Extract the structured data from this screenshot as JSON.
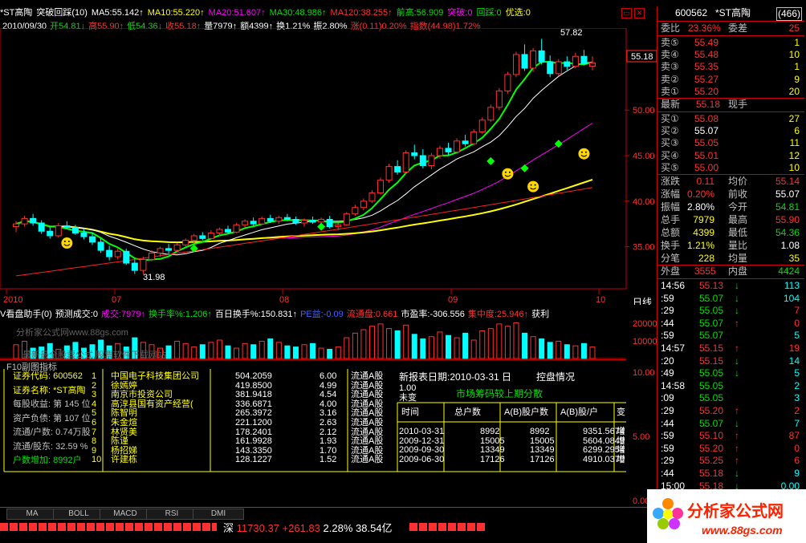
{
  "header": {
    "stock_title": "*ST高陶",
    "indicator": "突破回踩(10)",
    "ma5": "MA5:55.142↑",
    "ma10": "MA10:55.220↑",
    "ma20": "MA20:51.607↑",
    "ma30": "MA30:48.986↑",
    "ma120": "MA120:38.255↑",
    "prev_high": "前高:56.909",
    "breakout": "突破:0",
    "pullback": "回踩:0",
    "pick": "优选:0",
    "date": "2010/09/30",
    "open": "开54.81↓",
    "high": "高55.90↑",
    "low": "低54.36↓",
    "close": "收55.18↑",
    "volume": "量7979↑",
    "amount": "额4399↑",
    "turnover": "换1.21%",
    "amplitude": "振2.80%",
    "change": "涨(0.11)0.20%",
    "index": "指数(44.98)1.72%"
  },
  "chart_data": {
    "type": "candlestick",
    "x_labels": [
      "2010",
      "07",
      "08",
      "09",
      "10"
    ],
    "y_ticks": [
      35.0,
      40.0,
      45.0,
      50.0
    ],
    "price_tag": "55.18",
    "annotation_high": "57.82",
    "annotation_low": "31.98",
    "period_label": "日线",
    "ylim": [
      31,
      59
    ],
    "candles": [
      [
        37.2,
        37.8,
        36.6,
        37.5
      ],
      [
        37.5,
        38.4,
        37.2,
        38.1
      ],
      [
        38.1,
        38.6,
        37.3,
        37.6
      ],
      [
        37.6,
        37.9,
        36.4,
        36.7
      ],
      [
        36.7,
        37.2,
        35.9,
        36.2
      ],
      [
        36.2,
        37.6,
        36.0,
        37.3
      ],
      [
        37.3,
        37.8,
        36.9,
        37.1
      ],
      [
        37.1,
        37.4,
        36.3,
        36.5
      ],
      [
        36.5,
        36.9,
        35.8,
        36.1
      ],
      [
        36.1,
        36.6,
        35.2,
        35.5
      ],
      [
        35.5,
        35.9,
        34.3,
        34.6
      ],
      [
        34.6,
        35.1,
        33.5,
        33.9
      ],
      [
        33.9,
        34.8,
        33.6,
        34.5
      ],
      [
        34.5,
        34.8,
        33.0,
        33.2
      ],
      [
        33.2,
        33.6,
        32.0,
        32.4
      ],
      [
        32.4,
        33.9,
        31.98,
        33.6
      ],
      [
        33.6,
        34.6,
        33.4,
        34.3
      ],
      [
        34.3,
        35.0,
        33.9,
        34.8
      ],
      [
        34.8,
        35.3,
        34.2,
        34.6
      ],
      [
        34.6,
        35.4,
        34.4,
        35.2
      ],
      [
        35.2,
        35.9,
        35.0,
        35.7
      ],
      [
        35.7,
        36.4,
        35.4,
        36.2
      ],
      [
        36.2,
        36.6,
        35.7,
        35.9
      ],
      [
        35.9,
        36.8,
        35.8,
        36.5
      ],
      [
        36.5,
        37.1,
        36.2,
        36.9
      ],
      [
        36.9,
        37.3,
        36.4,
        36.6
      ],
      [
        36.6,
        37.6,
        36.5,
        37.4
      ],
      [
        37.4,
        38.0,
        37.1,
        37.8
      ],
      [
        37.8,
        38.2,
        37.3,
        37.5
      ],
      [
        37.5,
        38.3,
        37.4,
        38.1
      ],
      [
        38.1,
        38.5,
        37.6,
        37.8
      ],
      [
        37.8,
        38.4,
        37.5,
        38.2
      ],
      [
        38.2,
        38.6,
        37.8,
        38.0
      ],
      [
        38.0,
        38.3,
        37.4,
        37.6
      ],
      [
        37.6,
        38.1,
        37.2,
        37.9
      ],
      [
        37.9,
        38.3,
        37.5,
        37.7
      ],
      [
        37.7,
        38.2,
        37.3,
        38.0
      ],
      [
        38.0,
        38.4,
        37.0,
        37.2
      ],
      [
        37.2,
        37.6,
        36.8,
        37.4
      ],
      [
        37.4,
        38.8,
        37.3,
        38.6
      ],
      [
        38.6,
        39.6,
        38.4,
        39.3
      ],
      [
        39.3,
        40.3,
        39.0,
        40.0
      ],
      [
        40.0,
        41.2,
        39.8,
        40.9
      ],
      [
        40.9,
        42.6,
        40.7,
        42.3
      ],
      [
        42.3,
        44.1,
        42.0,
        43.8
      ],
      [
        43.8,
        44.5,
        42.9,
        43.2
      ],
      [
        43.2,
        45.6,
        43.0,
        45.3
      ],
      [
        45.3,
        46.2,
        44.6,
        45.0
      ],
      [
        45.0,
        45.7,
        43.6,
        43.9
      ],
      [
        43.9,
        45.3,
        43.5,
        45.0
      ],
      [
        45.0,
        46.1,
        44.7,
        45.8
      ],
      [
        45.8,
        46.4,
        45.1,
        45.4
      ],
      [
        45.4,
        46.9,
        45.2,
        46.6
      ],
      [
        46.6,
        47.3,
        46.0,
        46.3
      ],
      [
        46.3,
        47.9,
        46.1,
        47.6
      ],
      [
        47.6,
        49.2,
        47.4,
        48.9
      ],
      [
        48.9,
        50.6,
        48.7,
        50.3
      ],
      [
        50.3,
        52.4,
        50.0,
        52.1
      ],
      [
        52.1,
        54.2,
        51.8,
        53.9
      ],
      [
        53.9,
        56.4,
        53.6,
        56.1
      ],
      [
        56.1,
        57.2,
        54.3,
        54.6
      ],
      [
        54.6,
        56.8,
        54.2,
        56.5
      ],
      [
        56.5,
        57.82,
        55.0,
        55.3
      ],
      [
        55.3,
        56.0,
        53.6,
        54.0
      ],
      [
        54.0,
        55.6,
        53.7,
        55.3
      ],
      [
        55.3,
        55.9,
        54.4,
        54.8
      ],
      [
        54.8,
        56.3,
        54.6,
        55.9
      ],
      [
        55.9,
        56.6,
        54.9,
        55.07
      ],
      [
        54.81,
        55.9,
        54.36,
        55.18
      ]
    ],
    "vol_ticks": [
      "20000",
      "10000"
    ],
    "vol_values": [
      12,
      15,
      9,
      10,
      13,
      8,
      11,
      14,
      9,
      12,
      16,
      11,
      13,
      10,
      18,
      14,
      12,
      9,
      11,
      15,
      13,
      10,
      12,
      14,
      16,
      11,
      9,
      13,
      12,
      15,
      17,
      14,
      11,
      10,
      12,
      13,
      9,
      8,
      10,
      18,
      22,
      25,
      28,
      30,
      26,
      24,
      29,
      21,
      17,
      19,
      23,
      20,
      18,
      22,
      16,
      24,
      26,
      30,
      28,
      31,
      22,
      19,
      17,
      14,
      15,
      12,
      11,
      13,
      10
    ],
    "sub_ticks": [
      "10.00",
      "5.00",
      "0.00"
    ]
  },
  "sub_header": {
    "name": "V看盘助手(0)",
    "pred": "预测成交:0",
    "vol": "成交:7979↑",
    "turn": "换手率%:1.206↑",
    "hundred": "百日换手%:150.831↑",
    "pe": "PE益:-0.09",
    "float_cap": "流通盘:0.661",
    "pe_ratio": "市盈率:-306.556",
    "concentration": "集中度:25.946↑",
    "profit": "获利"
  },
  "watermark": {
    "line1": "分析家公式网www.88gs.com",
    "line2": "最新最全股票公式,股票软件下载网站"
  },
  "f10": {
    "title": "F10副图指标",
    "info": [
      {
        "text": "证券代码: 600562",
        "color": "#ffff00"
      },
      {
        "text": "证券名称: *ST高陶",
        "color": "#ffff00"
      },
      {
        "text": "每股收益: 第 145 位",
        "color": "#c0c0c0"
      },
      {
        "text": "资产负债: 第 107 位",
        "color": "#c0c0c0"
      },
      {
        "text": "流通/户数: 0.74万股",
        "color": "#c0c0c0"
      },
      {
        "text": "流通/股东: 32.59 %",
        "color": "#c0c0c0"
      },
      {
        "text": "户数增加: 8992户",
        "color": "#00e000"
      }
    ],
    "holders": [
      {
        "rank": "1",
        "name": "中国电子科技集团公司",
        "shares": "504.2059",
        "pct": "6.00",
        "type": "流通A股"
      },
      {
        "rank": "2",
        "name": "徐嫣婷",
        "shares": "419.8500",
        "pct": "4.99",
        "type": "流通A股"
      },
      {
        "rank": "3",
        "name": "南京市投资公司",
        "shares": "381.9418",
        "pct": "4.54",
        "type": "流通A股"
      },
      {
        "rank": "4",
        "name": "高淳县国有资产经营(",
        "shares": "336.6871",
        "pct": "4.00",
        "type": "流通A股"
      },
      {
        "rank": "5",
        "name": "陈智明",
        "shares": "265.3972",
        "pct": "3.16",
        "type": "流通A股"
      },
      {
        "rank": "6",
        "name": "朱金煊",
        "shares": "221.1200",
        "pct": "2.63",
        "type": "流通A股"
      },
      {
        "rank": "7",
        "name": "林贤美",
        "shares": "178.2401",
        "pct": "2.12",
        "type": "流通A股"
      },
      {
        "rank": "8",
        "name": "陈谨",
        "shares": "161.9928",
        "pct": "1.93",
        "type": "流通A股"
      },
      {
        "rank": "9",
        "name": "杨招娣",
        "shares": "143.3350",
        "pct": "1.70",
        "type": "流通A股"
      },
      {
        "rank": "10",
        "name": "许建栋",
        "shares": "128.1227",
        "pct": "1.52",
        "type": "流通A股"
      }
    ],
    "report_date": "新报表日期:2010-03-31 日",
    "control": "控盘情况",
    "ctrl_val": "1.00",
    "ctrl_note": "未变",
    "chip_title": "市场筹码较上期分散",
    "table_headers": [
      "时间",
      "总户数",
      "A(B)股户数",
      "A(B)股/户",
      "变"
    ],
    "table_rows": [
      [
        "2010-03-31",
        "8992",
        "8992",
        "9351.5674",
        "增"
      ],
      [
        "2009-12-31",
        "15005",
        "15005",
        "5604.0849",
        "增"
      ],
      [
        "2009-09-30",
        "13349",
        "13349",
        "6299.2954",
        "增"
      ],
      [
        "2009-06-30",
        "17126",
        "17126",
        "4910.0370",
        "增"
      ]
    ]
  },
  "tabs": [
    "MA",
    "BOLL",
    "MACD",
    "RSI",
    "DMI"
  ],
  "status": {
    "market": "深",
    "index_val": "11730.37",
    "change": "+261.83",
    "pct": "2.28%",
    "amount": "38.54亿"
  },
  "quote": {
    "code": "600562",
    "name": "*ST高陶",
    "rank": "(466)",
    "weibi_label": "委比",
    "weibi": "23.36%",
    "weicha_label": "委差",
    "weicha": "25",
    "sells": [
      {
        "label": "卖⑤",
        "price": "55.49",
        "vol": "1"
      },
      {
        "label": "卖④",
        "price": "55.48",
        "vol": "10"
      },
      {
        "label": "卖③",
        "price": "55.35",
        "vol": "1"
      },
      {
        "label": "卖②",
        "price": "55.27",
        "vol": "9"
      },
      {
        "label": "卖①",
        "price": "55.20",
        "vol": "20"
      }
    ],
    "last_label": "最新",
    "last": "55.18",
    "hand_label": "现手",
    "buys": [
      {
        "label": "买①",
        "price": "55.08",
        "vol": "27"
      },
      {
        "label": "买②",
        "price": "55.07",
        "vol": "6"
      },
      {
        "label": "买③",
        "price": "55.05",
        "vol": "11"
      },
      {
        "label": "买④",
        "price": "55.01",
        "vol": "12"
      },
      {
        "label": "买⑤",
        "price": "55.00",
        "vol": "10"
      }
    ],
    "stats": [
      {
        "l1": "涨跌",
        "v1": "0.11",
        "c1": "#ff3030",
        "l2": "均价",
        "v2": "55.14",
        "c2": "#ff3030"
      },
      {
        "l1": "涨幅",
        "v1": "0.20%",
        "c1": "#ff3030",
        "l2": "前收",
        "v2": "55.07",
        "c2": "#ffffff"
      },
      {
        "l1": "振幅",
        "v1": "2.80%",
        "c1": "#ffffff",
        "l2": "今开",
        "v2": "54.81",
        "c2": "#00e000"
      },
      {
        "l1": "总手",
        "v1": "7979",
        "c1": "#ffff00",
        "l2": "最高",
        "v2": "55.90",
        "c2": "#ff3030"
      },
      {
        "l1": "总额",
        "v1": "4399",
        "c1": "#ffff00",
        "l2": "最低",
        "v2": "54.36",
        "c2": "#00e000"
      },
      {
        "l1": "换手",
        "v1": "1.21%",
        "c1": "#ffff00",
        "l2": "量比",
        "v2": "1.08",
        "c2": "#ffffff"
      },
      {
        "l1": "分笔",
        "v1": "228",
        "c1": "#ffff00",
        "l2": "均量",
        "v2": "35",
        "c2": "#ffff00"
      }
    ],
    "outer_label": "外盘",
    "outer": "3555",
    "inner_label": "内盘",
    "inner": "4424",
    "ticks": [
      {
        "t": "14:56",
        "p": "55.13",
        "pc": "#ff3030",
        "a": "↓",
        "ac": "#00e000",
        "v": "113",
        "vc": "#00ffff"
      },
      {
        "t": ":59",
        "p": "55.07",
        "pc": "#00e000",
        "a": "↓",
        "ac": "#00e000",
        "v": "104",
        "vc": "#00ffff"
      },
      {
        "t": ":29",
        "p": "55.05",
        "pc": "#00e000",
        "a": "↓",
        "ac": "#00e000",
        "v": "7",
        "vc": "#ff3030"
      },
      {
        "t": ":44",
        "p": "55.07",
        "pc": "#00e000",
        "a": "↑",
        "ac": "#ff3030",
        "v": "0",
        "vc": "#ff3030"
      },
      {
        "t": ":59",
        "p": "55.07",
        "pc": "#00e000",
        "a": "",
        "ac": "#ffffff",
        "v": "5",
        "vc": "#00ffff"
      },
      {
        "t": "14:57",
        "p": "55.15",
        "pc": "#ff3030",
        "a": "↑",
        "ac": "#ff3030",
        "v": "19",
        "vc": "#ff3030"
      },
      {
        "t": ":20",
        "p": "55.15",
        "pc": "#ff3030",
        "a": "↓",
        "ac": "#00e000",
        "v": "14",
        "vc": "#00ffff"
      },
      {
        "t": ":49",
        "p": "55.05",
        "pc": "#00e000",
        "a": "↓",
        "ac": "#00e000",
        "v": "5",
        "vc": "#00ffff"
      },
      {
        "t": "14:58",
        "p": "55.05",
        "pc": "#00e000",
        "a": "",
        "ac": "#ffffff",
        "v": "2",
        "vc": "#00ffff"
      },
      {
        "t": ":09",
        "p": "55.05",
        "pc": "#00e000",
        "a": "",
        "ac": "#ffffff",
        "v": "3",
        "vc": "#00ffff"
      },
      {
        "t": ":29",
        "p": "55.20",
        "pc": "#ff3030",
        "a": "↑",
        "ac": "#ff3030",
        "v": "2",
        "vc": "#ff3030"
      },
      {
        "t": ":44",
        "p": "55.07",
        "pc": "#00e000",
        "a": "↓",
        "ac": "#00e000",
        "v": "7",
        "vc": "#00ffff"
      },
      {
        "t": ":59",
        "p": "55.10",
        "pc": "#ff3030",
        "a": "↑",
        "ac": "#ff3030",
        "v": "87",
        "vc": "#ff3030"
      },
      {
        "t": ":59",
        "p": "55.20",
        "pc": "#ff3030",
        "a": "↑",
        "ac": "#ff3030",
        "v": "0",
        "vc": "#ff3030"
      },
      {
        "t": ":29",
        "p": "55.25",
        "pc": "#ff3030",
        "a": "↑",
        "ac": "#ff3030",
        "v": "6",
        "vc": "#ff3030"
      },
      {
        "t": ":44",
        "p": "55.18",
        "pc": "#ff3030",
        "a": "↓",
        "ac": "#00e000",
        "v": "9",
        "vc": "#00ffff"
      },
      {
        "t": "15:00",
        "p": "55.18",
        "pc": "#ff3030",
        "a": "↓",
        "ac": "#00e000",
        "v": "0.00",
        "vc": "#00ffff"
      }
    ]
  },
  "logo": {
    "text": "分析家公式网",
    "url_text": "www.88gs.com"
  }
}
